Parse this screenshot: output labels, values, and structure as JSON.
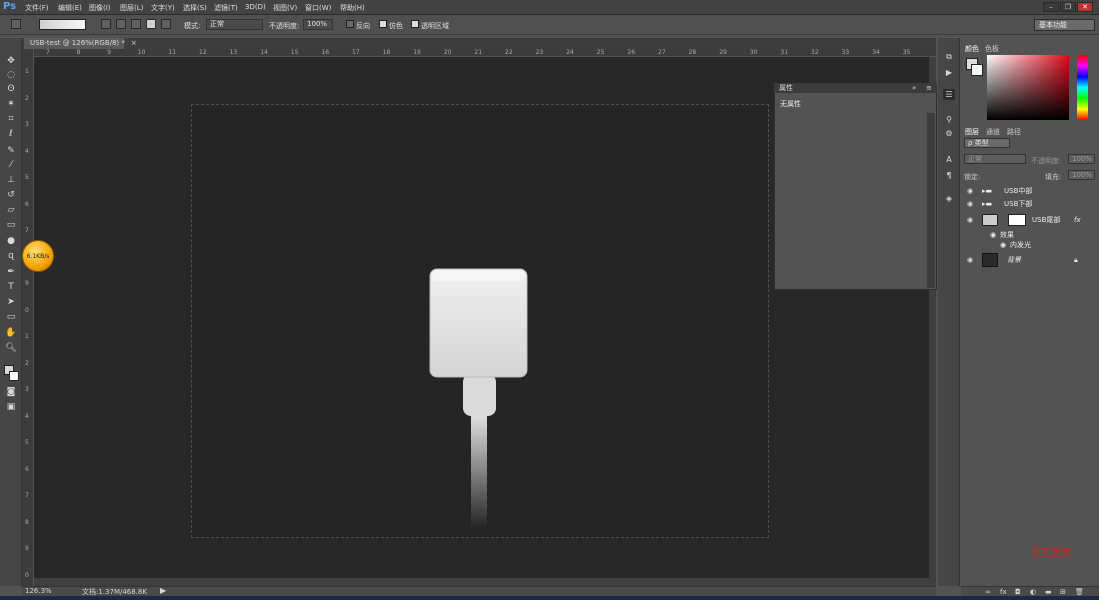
{
  "app": {
    "logo": "Ps",
    "colors": {
      "accent": "#5aa3e6",
      "canvas_bg": "#252525",
      "workspace_bg": "#282828"
    }
  },
  "menu": [
    "文件(F)",
    "编辑(E)",
    "图像(I)",
    "图层(L)",
    "文字(Y)",
    "选择(S)",
    "滤镜(T)",
    "3D(D)",
    "视图(V)",
    "窗口(W)",
    "帮助(H)"
  ],
  "options": {
    "mode_label": "模式:",
    "mode_value": "正常",
    "opacity_label": "不透明度:",
    "opacity_value": "100%",
    "reverse_label": "反向",
    "dither_label": "仿色",
    "transparency_label": "透明区域",
    "workspace": "基本功能"
  },
  "document": {
    "tab": "USB-test @ 126%(RGB/8) *",
    "zoom": "126.3%",
    "doc_info": "文档:1.37M/468.8K",
    "ruler_ticks": [
      "7",
      "8",
      "9",
      "10",
      "11",
      "12",
      "13",
      "14",
      "15",
      "16",
      "17",
      "18",
      "19",
      "20",
      "21",
      "22",
      "23",
      "24",
      "25",
      "26",
      "27",
      "28",
      "29",
      "30",
      "31",
      "32",
      "33",
      "34",
      "35"
    ],
    "vruler_ticks": [
      "1",
      "2",
      "3",
      "4",
      "5",
      "6",
      "7",
      "8",
      "9",
      "0",
      "1",
      "2",
      "3",
      "4",
      "5",
      "6",
      "7",
      "8",
      "9",
      "0"
    ]
  },
  "properties": {
    "title": "属性",
    "value": "无属性"
  },
  "panels": {
    "color_tab": "颜色",
    "swatch_tab": "色板",
    "layers_tab": "图层",
    "channels_tab": "通道",
    "paths_tab": "路径"
  },
  "layers_panel": {
    "filter": "ρ 类型",
    "blend": "正常",
    "opacity_label": "不透明度:",
    "opacity": "100%",
    "lock_label": "锁定:",
    "fill_label": "填充:",
    "fill": "100%",
    "layers": [
      {
        "name": "USB中部",
        "kind": "group"
      },
      {
        "name": "USB下部",
        "kind": "group"
      },
      {
        "name": "USB尾部",
        "kind": "layer"
      },
      {
        "name": "效果",
        "kind": "effects"
      },
      {
        "name": "内发光",
        "kind": "effect"
      },
      {
        "name": "背景",
        "kind": "background"
      }
    ]
  },
  "overlay": {
    "speed": "6.1KB/s",
    "watermark": "文艺至死"
  }
}
